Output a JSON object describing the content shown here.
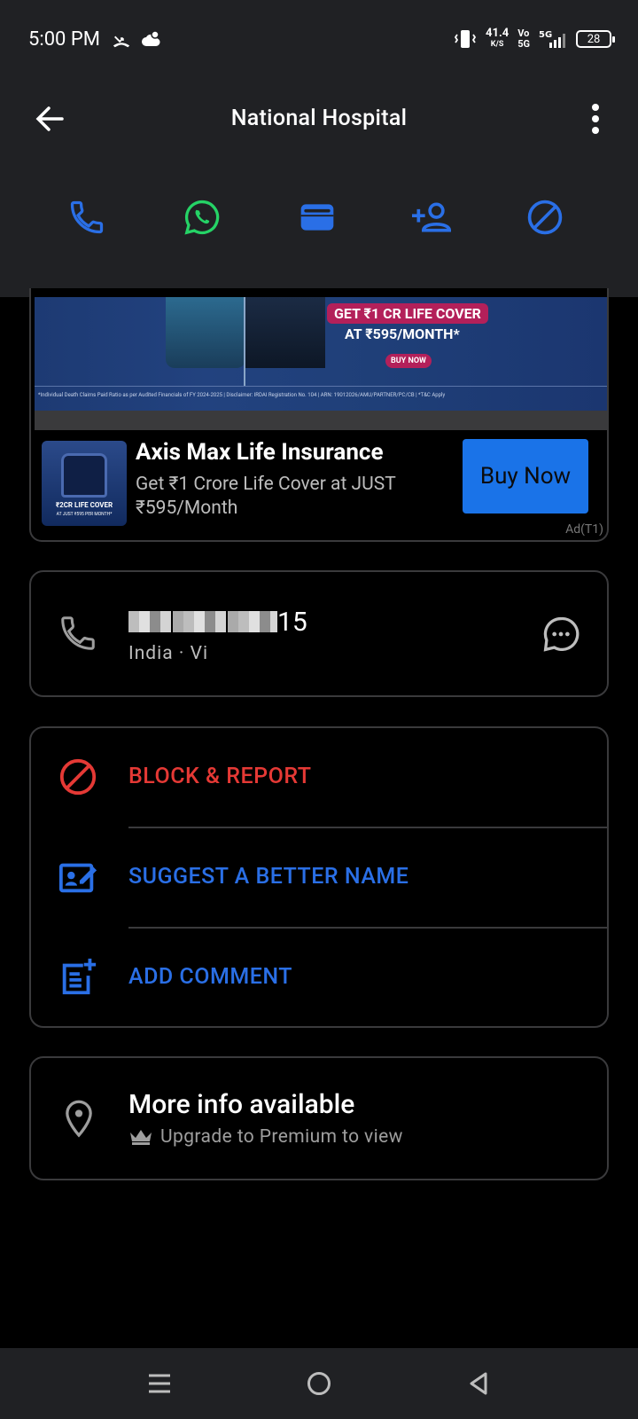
{
  "status_bar": {
    "time": "5:00 PM",
    "net_speed": "41.4",
    "net_unit": "K/S",
    "volte_top": "Vo",
    "volte_bottom": "5G",
    "signal": "5G",
    "battery": "28"
  },
  "header": {
    "title": "National Hospital"
  },
  "actions": [
    {
      "name": "call",
      "icon": "phone-icon"
    },
    {
      "name": "whatsapp",
      "icon": "whatsapp-icon"
    },
    {
      "name": "wallet",
      "icon": "wallet-icon"
    },
    {
      "name": "add-contact",
      "icon": "add-person-icon"
    },
    {
      "name": "block",
      "icon": "block-icon"
    }
  ],
  "ad": {
    "banner_line1": "GET ₹1 CR LIFE COVER",
    "banner_line2": "AT ₹595/MONTH*",
    "banner_cta": "BUY NOW",
    "banner_disclaimer": "*Individual Death Claims Paid Ratio as per Audited Financials of FY 2024-2025 | Disclaimer: IRDAI Registration No. 104 | ARN: 19012026/AMU/PARTNER/PC/CB | *T&C Apply",
    "thumb_text": "₹2CR LIFE COVER",
    "thumb_sub": "AT JUST ₹595 PER MONTH*",
    "title": "Axis Max Life Insurance",
    "description": "Get ₹1 Crore Life Cover at JUST ₹595/Month",
    "button": "Buy Now",
    "label": "Ad(T1)"
  },
  "phone": {
    "number_suffix": "15",
    "subtitle": "India · Vi"
  },
  "options": {
    "block": "BLOCK & REPORT",
    "suggest": "SUGGEST A BETTER NAME",
    "comment": "ADD COMMENT"
  },
  "info": {
    "title": "More info available",
    "subtitle": "Upgrade to Premium to view"
  },
  "colors": {
    "accent": "#2a6fe6",
    "danger": "#e53935",
    "whatsapp": "#25d366",
    "bar_bg": "#202124"
  }
}
